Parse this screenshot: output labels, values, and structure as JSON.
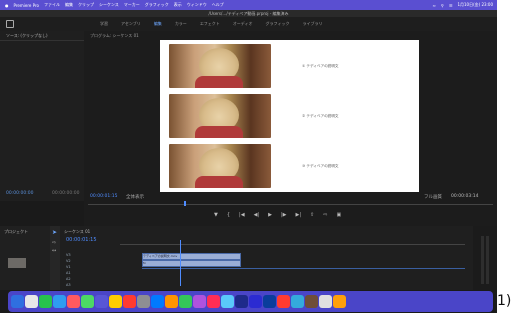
{
  "menubar": {
    "items": [
      "Premiere Pro",
      "ファイル",
      "編集",
      "クリップ",
      "シーケンス",
      "マーカー",
      "グラフィック",
      "表示",
      "ウィンドウ",
      "ヘルプ"
    ],
    "time": "1月10日(金) 23:00"
  },
  "window": {
    "title": "/Users/…/テディベア動画.prproj - 編集済み"
  },
  "workspaces": {
    "tabs": [
      "学習",
      "アセンブリ",
      "編集",
      "カラー",
      "エフェクト",
      "オーディオ",
      "グラフィック",
      "ライブラリ"
    ],
    "active": "編集"
  },
  "source_panel": {
    "title": "ソース: (クリップなし)"
  },
  "program_panel": {
    "title": "プログラム: シーケンス 01"
  },
  "frame_captions": [
    "① テディベアの説明文",
    "② テディベアの説明文",
    "③ テディベアの説明文"
  ],
  "source_time": {
    "left": "00:00:00:00",
    "right": "00:00:00:00"
  },
  "program_time": {
    "current": "00:00:01:15",
    "zoom": "全体表示",
    "quality": "フル画質",
    "duration": "00:00:03:14"
  },
  "project_panel": {
    "title": "プロジェクト"
  },
  "timeline": {
    "title": "シーケンス 01",
    "timecode": "00:00:01:15",
    "tracks": [
      "V3",
      "V2",
      "V1",
      "A1",
      "A2",
      "A3"
    ],
    "clip_v2_label": "テディベアの説明文.mov",
    "clip_v1_label": "fx"
  },
  "page_number": "1)",
  "colors": {
    "menubar": "#5a4fd1",
    "dock": "#4a45c8",
    "accent": "#6ea8ff",
    "timecode": "#4f8cff"
  }
}
